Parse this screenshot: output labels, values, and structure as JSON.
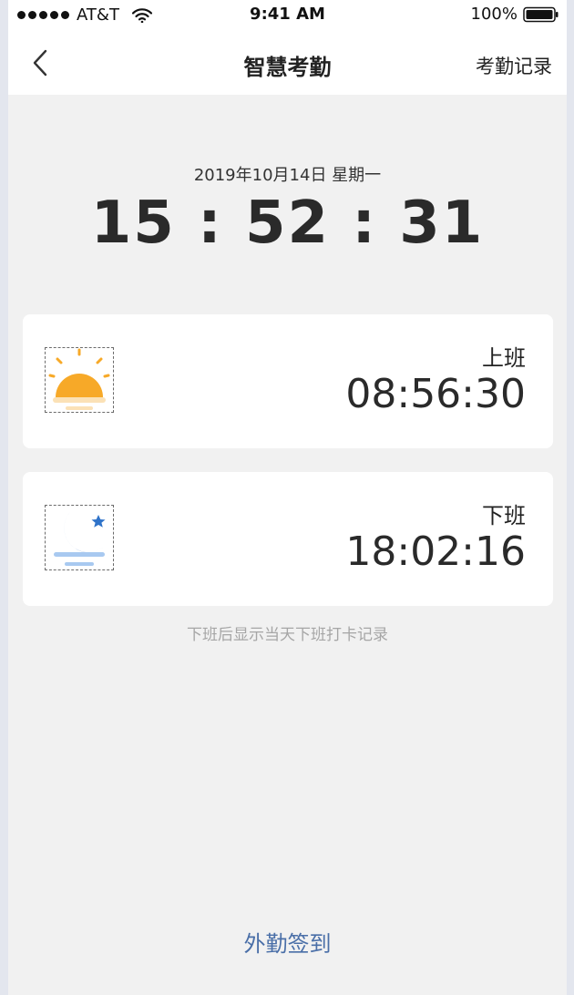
{
  "status_bar": {
    "carrier": "AT&T",
    "time": "9:41 AM",
    "battery": "100%"
  },
  "nav": {
    "title": "智慧考勤",
    "action": "考勤记录"
  },
  "clock": {
    "date": "2019年10月14日 星期一",
    "time": "15 : 52 : 31"
  },
  "checkin": {
    "label": "上班",
    "time": "08:56:30",
    "icon": "sun-icon"
  },
  "checkout": {
    "label": "下班",
    "time": "18:02:16",
    "icon": "moon-icon"
  },
  "hint": "下班后显示当天下班打卡记录",
  "field_checkin_label": "外勤签到",
  "colors": {
    "background": "#f1f1f1",
    "accent_link": "#4a6fa8",
    "sun": "#f7a928",
    "moon": "#2f73c9"
  }
}
